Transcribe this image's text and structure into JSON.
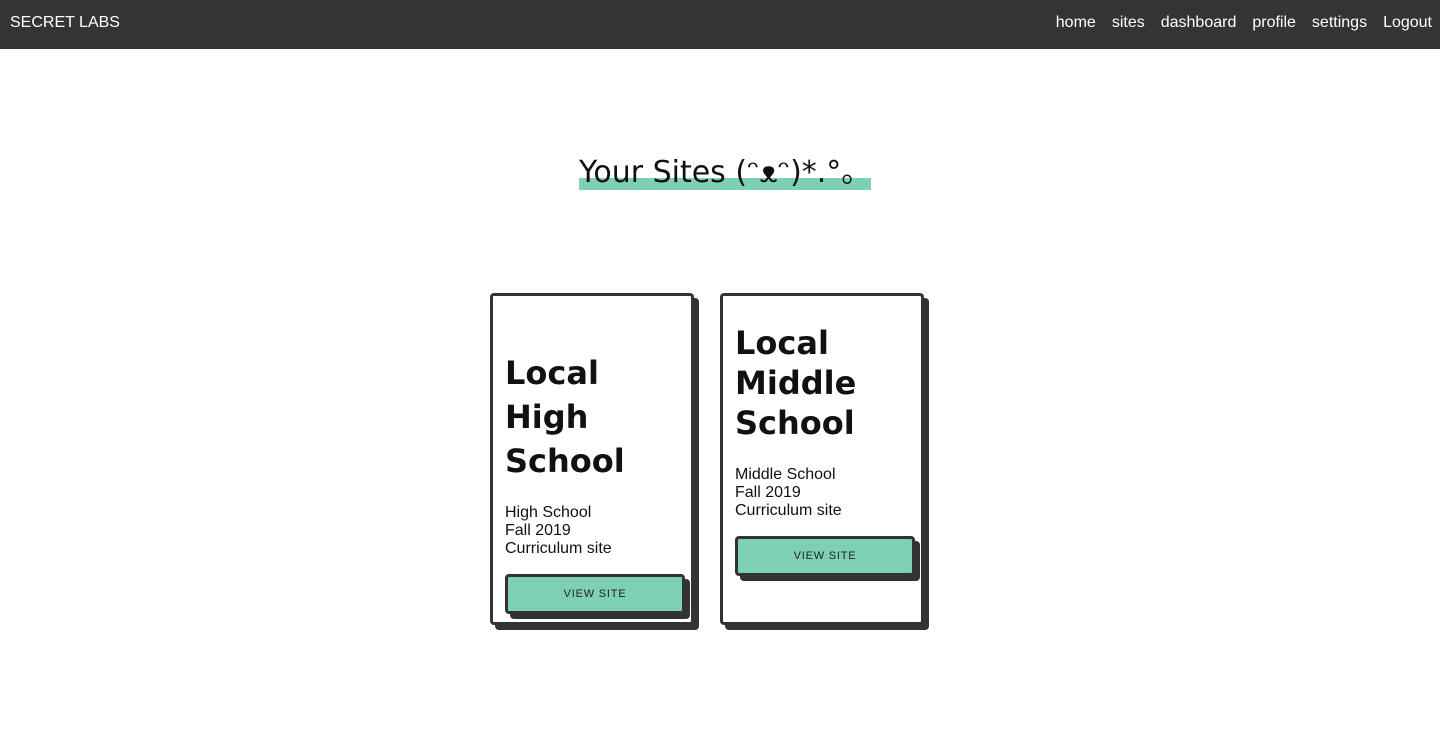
{
  "navbar": {
    "brand": "SECRET LABS",
    "links": [
      "home",
      "sites",
      "dashboard",
      "profile",
      "settings",
      "Logout"
    ]
  },
  "main": {
    "title": "Your Sites (ᵔᴥᵔ)*.°。",
    "accent_color": "#7dcfb6"
  },
  "sites": [
    {
      "title": "Local High School",
      "description_lines": [
        "High School",
        "Fall 2019",
        "Curriculum site"
      ],
      "button_label": "VIEW SITE"
    },
    {
      "title": "Local Middle School",
      "description_lines": [
        "Middle School",
        "Fall 2019",
        "Curriculum site"
      ],
      "button_label": "VIEW SITE"
    }
  ]
}
